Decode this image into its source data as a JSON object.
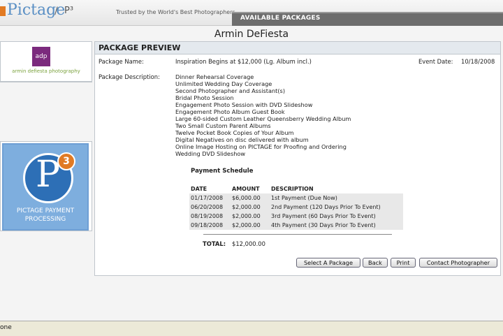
{
  "header": {
    "logo_text": "Pictage",
    "logo_sep": "/",
    "logo_sub": "P³",
    "tagline": "Trusted by the World's Best Photographers",
    "tab_label": "AVAILABLE PACKAGES"
  },
  "photographer_name": "Armin DeFiesta",
  "sidebar": {
    "brand_mark": "adp",
    "brand_text": "armin defiesta photography",
    "p3_letter": "P",
    "p3_badge": "3",
    "p3_caption_line1": "PICTAGE PAYMENT",
    "p3_caption_line2": "PROCESSING"
  },
  "panel": {
    "title": "PACKAGE PREVIEW",
    "package_name_label": "Package Name:",
    "package_name": "Inspiration Begins at $12,000 (Lg. Album incl.)",
    "event_date_label": "Event Date:",
    "event_date": "10/18/2008",
    "description_label": "Package Description:",
    "description_items": [
      "Dinner Rehearsal Coverage",
      "Unlimited Wedding Day Coverage",
      "Second Photographer and Assistant(s)",
      "Bridal Photo Session",
      "Engagement Photo Session with DVD Slideshow",
      "Engagement Photo Album Guest Book",
      "Large 60-sided Custom Leather Queensberry Wedding Album",
      "Two Small Custom Parent Albums",
      "Twelve Pocket Book Copies of Your Album",
      "Digital Negatives on disc delivered with album",
      "Online Image Hosting on PICTAGE for Proofing and Ordering",
      "Wedding DVD Slideshow"
    ],
    "schedule": {
      "title": "Payment Schedule",
      "headers": [
        "DATE",
        "AMOUNT",
        "DESCRIPTION"
      ],
      "rows": [
        [
          "01/17/2008",
          "$6,000.00",
          "1st Payment (Due Now)"
        ],
        [
          "06/20/2008",
          "$2,000.00",
          "2nd Payment (120 Days Prior To Event)"
        ],
        [
          "08/19/2008",
          "$2,000.00",
          "3rd Payment (60 Days Prior To Event)"
        ],
        [
          "09/18/2008",
          "$2,000.00",
          "4th Payment (30 Days Prior To Event)"
        ]
      ],
      "total_label": "TOTAL:",
      "total_value": "$12,000.00"
    },
    "buttons": {
      "select": "Select A Package",
      "back": "Back",
      "print": "Print",
      "contact": "Contact Photographer"
    }
  },
  "statusbar": {
    "text": "one"
  },
  "colors": {
    "accent_orange": "#e27a22",
    "brand_blue": "#2d6fb6",
    "tab_gray": "#6d6d6d",
    "brand_purple": "#7b2a7d",
    "brand_green": "#7ba23e"
  }
}
